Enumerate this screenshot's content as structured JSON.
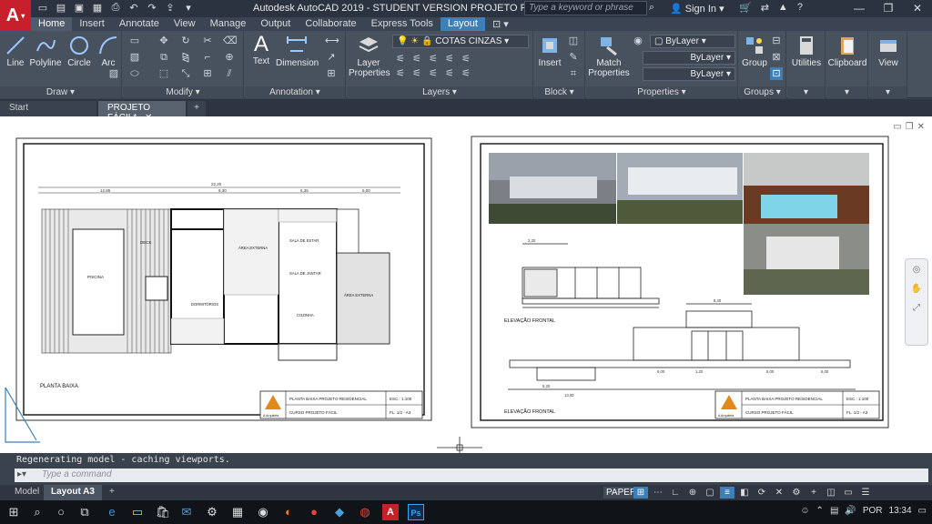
{
  "app": {
    "logo_letter": "A",
    "title": "Autodesk AutoCAD 2019 - STUDENT VERSION    PROJETO FÁCIL.dwg",
    "search_placeholder": "Type a keyword or phrase",
    "sign_in": "Sign In"
  },
  "ribbon_tabs": [
    "Home",
    "Insert",
    "Annotate",
    "View",
    "Manage",
    "Output",
    "Collaborate",
    "Express Tools",
    "Layout"
  ],
  "panels": {
    "draw": {
      "title": "Draw",
      "tools": [
        "Line",
        "Polyline",
        "Circle",
        "Arc"
      ]
    },
    "modify": {
      "title": "Modify"
    },
    "annotation": {
      "title": "Annotation",
      "tools": [
        "Text",
        "Dimension"
      ]
    },
    "layers": {
      "title": "Layers",
      "tool": "Layer Properties",
      "current_layer": "COTAS CINZAS"
    },
    "block": {
      "title": "Block",
      "tool": "Insert"
    },
    "properties": {
      "title": "Properties",
      "tool": "Match Properties",
      "color": "ByLayer",
      "linetype": "ByLayer",
      "lineweight": "ByLayer"
    },
    "groups": {
      "title": "Groups",
      "tool": "Group"
    },
    "utilities": {
      "tool": "Utilities"
    },
    "clipboard": {
      "tool": "Clipboard"
    },
    "view": {
      "tool": "View"
    }
  },
  "doc_tabs": {
    "start": "Start",
    "active": "PROJETO FÁCIL*"
  },
  "drawing": {
    "sheet1": {
      "title": "PLANTA BAIXA",
      "rooms": [
        "PISCINA",
        "DECK",
        "DORMITÓRIOS",
        "ÁREA EXTERNA",
        "SALA DE ESTAR",
        "SALA DE JANTAR",
        "ÁREA EXTERNA",
        "COZINHA"
      ],
      "dims_top": [
        "22,20",
        "12,85",
        "9,30",
        "6,35",
        "6,00"
      ],
      "title_block": {
        "name": "PLANTA BAIXA PROJETO RESIDENCIAL",
        "scale": "ESC.: 1:100",
        "course": "CURSO PROJETO FÁCIL",
        "sheet": "FL. 1/2 - A3",
        "brand": "A Arquiteta"
      }
    },
    "sheet2": {
      "label1": "ELEVAÇÃO FRONTAL",
      "label2": "ELEVAÇÃO FRONTAL",
      "dims": [
        "2,20",
        "8,40",
        "13,00",
        "5,20",
        "6,00",
        "1,20",
        "5,00",
        "6,00"
      ],
      "title_block": {
        "name": "PLANTA BAIXA PROJETO RESIDENCIAL",
        "scale": "ESC.: 1:100",
        "course": "CURSO PROJETO FÁCIL",
        "sheet": "FL. 1/2 - A3",
        "brand": "A Arquiteta"
      }
    }
  },
  "command": {
    "history": "Regenerating model - caching viewports.",
    "placeholder": "Type a command"
  },
  "layout_tabs": {
    "model": "Model",
    "active": "Layout A3"
  },
  "status": {
    "space": "PAPER"
  },
  "tray": {
    "language": "POR",
    "time": "13:34"
  }
}
